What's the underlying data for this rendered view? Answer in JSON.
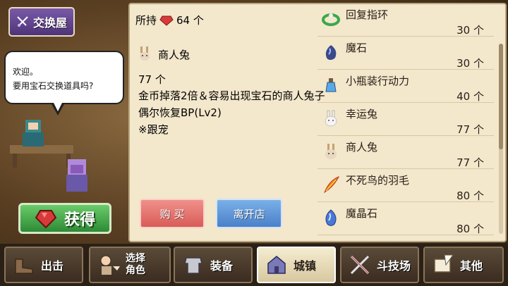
{
  "shop": {
    "title": "交换屋"
  },
  "npc": {
    "line1": "欢迎。",
    "line2": "要用宝石交换道具吗?"
  },
  "obtain_label": "获得",
  "owned": {
    "label": "所持",
    "count": "64 个"
  },
  "detail": {
    "name": "商人兔",
    "price": "77 个",
    "desc1": "金币掉落2倍＆容易出现宝石的商人兔子",
    "desc2": "偶尔恢复BP(Lv2)",
    "desc3": "※跟宠"
  },
  "buttons": {
    "buy": "购 买",
    "leave": "离开店"
  },
  "items": [
    {
      "name": "回复指环",
      "price": "30 个",
      "icon": "ring-icon"
    },
    {
      "name": "魔石",
      "price": "30 个",
      "icon": "magic-stone-icon"
    },
    {
      "name": "小瓶装行动力",
      "price": "40 个",
      "icon": "potion-icon"
    },
    {
      "name": "幸运兔",
      "price": "77 个",
      "icon": "lucky-rabbit-icon"
    },
    {
      "name": "商人兔",
      "price": "77 个",
      "icon": "merchant-rabbit-icon"
    },
    {
      "name": "不死鸟的羽毛",
      "price": "80 个",
      "icon": "phoenix-feather-icon"
    },
    {
      "name": "魔晶石",
      "price": "80 个",
      "icon": "magic-crystal-icon"
    }
  ],
  "nav": {
    "sortie": "出击",
    "select1": "选择",
    "select2": "角色",
    "equip": "装备",
    "town": "城镇",
    "arena": "斗技场",
    "other": "其他"
  }
}
